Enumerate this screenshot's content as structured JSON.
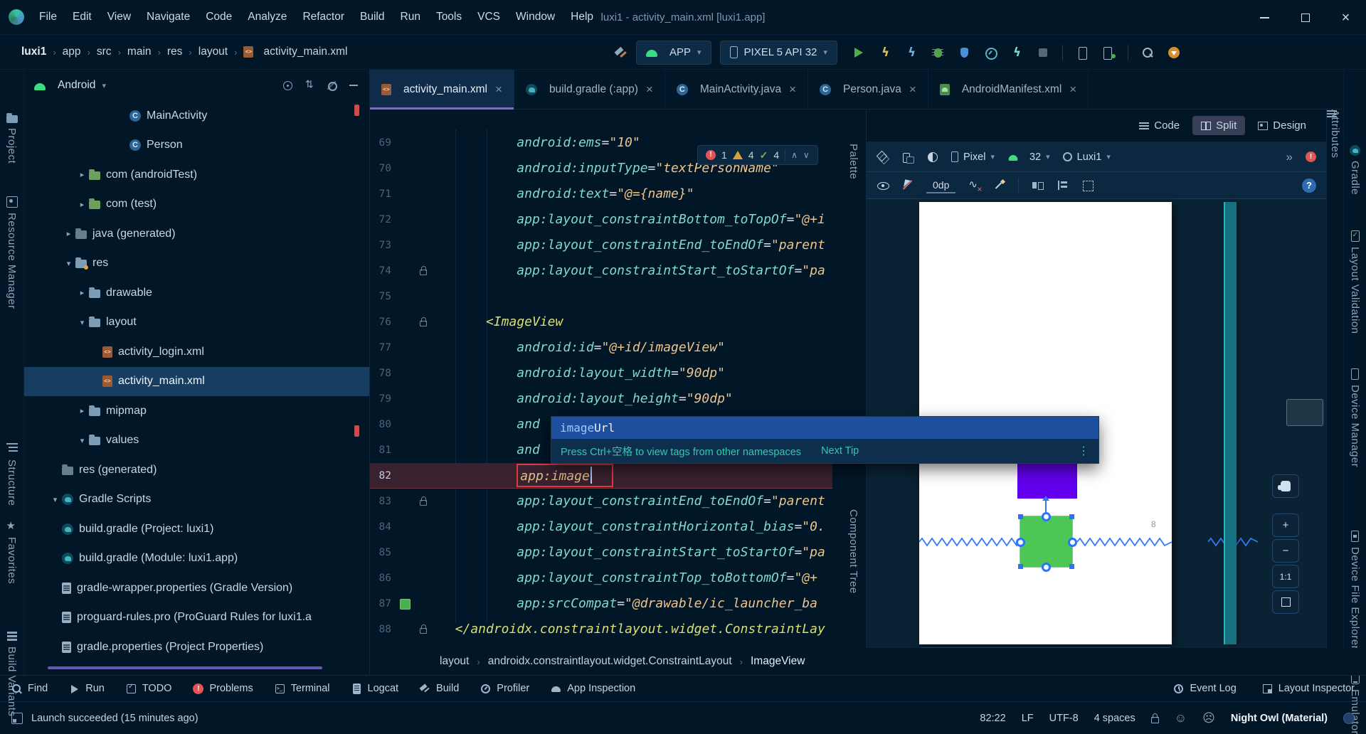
{
  "titlebar": {
    "menus": [
      "File",
      "Edit",
      "View",
      "Navigate",
      "Code",
      "Analyze",
      "Refactor",
      "Build",
      "Run",
      "Tools",
      "VCS",
      "Window",
      "Help"
    ],
    "title": "luxi1 - activity_main.xml [luxi1.app]"
  },
  "navbar": {
    "crumbs": [
      "luxi1",
      "app",
      "src",
      "main",
      "res",
      "layout",
      "activity_main.xml"
    ],
    "run_config": "APP",
    "device": "PIXEL 5 API 32",
    "actions": [
      "run",
      "apply-changes",
      "apply-code-changes",
      "debug",
      "profile-low-overhead",
      "profiler",
      "attach-debugger",
      "stop",
      "device-manager",
      "pair-devices",
      "search-everywhere",
      "ide-updates"
    ]
  },
  "tool_stripes": {
    "left": [
      {
        "label": "Project",
        "icon": "project"
      },
      {
        "label": "Resource Manager",
        "icon": "resource-manager"
      },
      {
        "label": "Structure",
        "icon": "structure"
      },
      {
        "label": "Favorites",
        "icon": "favorites"
      },
      {
        "label": "Build Variants",
        "icon": "build-variants"
      }
    ],
    "right": [
      {
        "label": "Gradle",
        "icon": "gradle"
      },
      {
        "label": "Layout Validation",
        "icon": "layout-validation"
      },
      {
        "label": "Device Manager",
        "icon": "device-manager"
      },
      {
        "label": "Device File Explorer",
        "icon": "device-file-explorer"
      },
      {
        "label": "Emulator",
        "icon": "emulator"
      }
    ],
    "attributes_tab": "Attributes"
  },
  "project": {
    "view": "Android",
    "items": [
      {
        "label": "MainActivity",
        "icon": "class",
        "level": 6,
        "chev": ""
      },
      {
        "label": "Person",
        "icon": "class",
        "level": 6,
        "chev": ""
      },
      {
        "label": "com (androidTest)",
        "icon": "folder-test",
        "level": 2,
        "chev": "▸"
      },
      {
        "label": "com (test)",
        "icon": "folder-test",
        "level": 2,
        "chev": "▸"
      },
      {
        "label": "java (generated)",
        "icon": "folder-gen",
        "level": 1,
        "chev": "▸"
      },
      {
        "label": "res",
        "icon": "folder-res",
        "level": 1,
        "chev": "▾"
      },
      {
        "label": "drawable",
        "icon": "folder",
        "level": 2,
        "chev": "▸"
      },
      {
        "label": "layout",
        "icon": "folder",
        "level": 2,
        "chev": "▾"
      },
      {
        "label": "activity_login.xml",
        "icon": "xml",
        "level": 4,
        "chev": ""
      },
      {
        "label": "activity_main.xml",
        "icon": "xml",
        "level": 4,
        "chev": "",
        "selected": true
      },
      {
        "label": "mipmap",
        "icon": "folder",
        "level": 2,
        "chev": "▸"
      },
      {
        "label": "values",
        "icon": "folder",
        "level": 2,
        "chev": "▾"
      },
      {
        "label": "res (generated)",
        "icon": "folder-gen",
        "level": 1,
        "chev": ""
      },
      {
        "label": "Gradle Scripts",
        "icon": "gradle",
        "level": 0,
        "chev": "▾"
      },
      {
        "label": "build.gradle (Project: luxi1)",
        "icon": "gradle",
        "level": 1,
        "chev": ""
      },
      {
        "label": "build.gradle (Module: luxi1.app)",
        "icon": "gradle",
        "level": 1,
        "chev": ""
      },
      {
        "label": "gradle-wrapper.properties (Gradle Version)",
        "icon": "file",
        "level": 1,
        "chev": ""
      },
      {
        "label": "proguard-rules.pro (ProGuard Rules for luxi1.a",
        "icon": "file",
        "level": 1,
        "chev": ""
      },
      {
        "label": "gradle.properties (Project Properties)",
        "icon": "file",
        "level": 1,
        "chev": ""
      }
    ]
  },
  "editor": {
    "tabs": [
      {
        "label": "activity_main.xml",
        "icon": "xml",
        "selected": true
      },
      {
        "label": "build.gradle (:app)",
        "icon": "gradle"
      },
      {
        "label": "MainActivity.java",
        "icon": "class"
      },
      {
        "label": "Person.java",
        "icon": "class"
      },
      {
        "label": "AndroidManifest.xml",
        "icon": "manifest"
      }
    ],
    "view_modes": [
      {
        "label": "Code"
      },
      {
        "label": "Split",
        "selected": true
      },
      {
        "label": "Design"
      }
    ],
    "inspection": {
      "errors": "1",
      "warnings": "4",
      "passed": "4"
    },
    "lines": [
      {
        "n": "69",
        "ind": 10,
        "tok": [
          [
            "a",
            "android:ems"
          ],
          [
            "o",
            "="
          ],
          [
            "v",
            "\"10\""
          ]
        ]
      },
      {
        "n": "70",
        "ind": 10,
        "tok": [
          [
            "a",
            "android:inputType"
          ],
          [
            "o",
            "="
          ],
          [
            "v",
            "\"textPersonName\""
          ]
        ]
      },
      {
        "n": "71",
        "ind": 10,
        "tok": [
          [
            "a",
            "android:text"
          ],
          [
            "o",
            "="
          ],
          [
            "v",
            "\"@={name}\""
          ]
        ]
      },
      {
        "n": "72",
        "ind": 10,
        "tok": [
          [
            "a",
            "app:layout_constraintBottom_toTopOf"
          ],
          [
            "o",
            "="
          ],
          [
            "v",
            "\"@+i"
          ]
        ]
      },
      {
        "n": "73",
        "ind": 10,
        "tok": [
          [
            "a",
            "app:layout_constraintEnd_toEndOf"
          ],
          [
            "o",
            "="
          ],
          [
            "v",
            "\"parent"
          ]
        ]
      },
      {
        "n": "74",
        "ind": 10,
        "tok": [
          [
            "a",
            "app:layout_constraintStart_toStartOf"
          ],
          [
            "o",
            "="
          ],
          [
            "v",
            "\"pa"
          ]
        ],
        "lock": true
      },
      {
        "n": "75",
        "ind": 0,
        "tok": []
      },
      {
        "n": "76",
        "ind": 6,
        "tok": [
          [
            "t",
            "<ImageView"
          ]
        ],
        "lock": true
      },
      {
        "n": "77",
        "ind": 10,
        "tok": [
          [
            "a",
            "android:id"
          ],
          [
            "o",
            "="
          ],
          [
            "v",
            "\"@+id/imageView\""
          ]
        ]
      },
      {
        "n": "78",
        "ind": 10,
        "tok": [
          [
            "a",
            "android:layout_width"
          ],
          [
            "o",
            "="
          ],
          [
            "v",
            "\"90dp\""
          ]
        ]
      },
      {
        "n": "79",
        "ind": 10,
        "tok": [
          [
            "a",
            "android:layout_height"
          ],
          [
            "o",
            "="
          ],
          [
            "v",
            "\"90dp\""
          ]
        ]
      },
      {
        "n": "80",
        "ind": 10,
        "tok": [
          [
            "a",
            "and"
          ]
        ]
      },
      {
        "n": "81",
        "ind": 10,
        "tok": [
          [
            "a",
            "and"
          ]
        ]
      },
      {
        "n": "82",
        "ind": 10,
        "tok": [
          [
            "inc",
            "app:image"
          ]
        ],
        "current": true,
        "boxed": true,
        "caret": true
      },
      {
        "n": "83",
        "ind": 10,
        "tok": [
          [
            "a",
            "app:layout_constraintEnd_toEndOf"
          ],
          [
            "o",
            "="
          ],
          [
            "v",
            "\"parent"
          ]
        ],
        "lock": true
      },
      {
        "n": "84",
        "ind": 10,
        "tok": [
          [
            "a",
            "app:layout_constraintHorizontal_bias"
          ],
          [
            "o",
            "="
          ],
          [
            "v",
            "\"0."
          ]
        ]
      },
      {
        "n": "85",
        "ind": 10,
        "tok": [
          [
            "a",
            "app:layout_constraintStart_toStartOf"
          ],
          [
            "o",
            "="
          ],
          [
            "v",
            "\"pa"
          ]
        ]
      },
      {
        "n": "86",
        "ind": 10,
        "tok": [
          [
            "a",
            "app:layout_constraintTop_toBottomOf"
          ],
          [
            "o",
            "="
          ],
          [
            "v",
            "\"@+"
          ]
        ]
      },
      {
        "n": "87",
        "ind": 10,
        "tok": [
          [
            "a",
            "app:srcCompat"
          ],
          [
            "o",
            "="
          ],
          [
            "v",
            "\"@drawable/ic_launcher_ba"
          ]
        ],
        "swatch": "#4caf50"
      },
      {
        "n": "88",
        "ind": 2,
        "tok": [
          [
            "t",
            "</androidx.constraintlayout.widget.ConstraintLay"
          ]
        ],
        "lock": true
      }
    ],
    "breadcrumbs": [
      "layout",
      "androidx.constraintlayout.widget.ConstraintLayout",
      "ImageView"
    ]
  },
  "popup": {
    "completion_match": "image",
    "completion_rest": "Url",
    "hint": "Press Ctrl+空格 to view tags from other namespaces",
    "hint_action": "Next Tip"
  },
  "design": {
    "device": "Pixel",
    "api": "32",
    "theme_config": "Luxi1",
    "default_margin": "0dp",
    "palette": "Palette",
    "component_tree": "Component Tree",
    "margin_label": "8",
    "zoom_controls": [
      "+",
      "−",
      "1:1"
    ]
  },
  "bottom_bar": {
    "left": [
      {
        "label": "Find",
        "icon": "find"
      },
      {
        "label": "Run",
        "icon": "play"
      },
      {
        "label": "TODO",
        "icon": "todo"
      },
      {
        "label": "Problems",
        "icon": "error"
      },
      {
        "label": "Terminal",
        "icon": "terminal"
      },
      {
        "label": "Logcat",
        "icon": "logcat"
      },
      {
        "label": "Build",
        "icon": "build"
      },
      {
        "label": "Profiler",
        "icon": "profiler"
      },
      {
        "label": "App Inspection",
        "icon": "inspection"
      }
    ],
    "right": [
      {
        "label": "Event Log",
        "icon": "event-log"
      },
      {
        "label": "Layout Inspector",
        "icon": "layout-inspector"
      }
    ]
  },
  "status_bar": {
    "message": "Launch succeeded (15 minutes ago)",
    "caret_position": "82:22",
    "line_separator": "LF",
    "encoding": "UTF-8",
    "indent_style": "4 spaces",
    "theme": "Night Owl (Material)"
  },
  "colors": {
    "view_green": "#4dc557",
    "view_purple": "#6200ee",
    "constraint_blue": "#3677f6",
    "accent": "#8a63d2"
  }
}
